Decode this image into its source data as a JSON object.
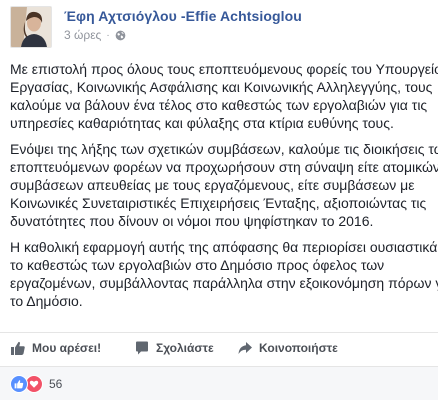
{
  "post": {
    "author": "Έφη Αχτσιόγλου -Effie Achtsioglou",
    "timestamp": "3 ώρες",
    "privacy_icon": "globe-icon",
    "avatar_icon": "profile-photo",
    "paragraphs": [
      {
        "lines": [
          "Με επιστολή προς όλους τους εποπτευόμενους φορείς του Υπουργείου",
          "Εργασίας, Κοινωνικής Ασφάλισης και Κοινωνικής Αλληλεγγύης, τους",
          "καλούμε να βάλουν ένα τέλος στο καθεστώς των εργολαβιών για τις",
          "υπηρεσίες καθαριότητας και φύλαξης στα κτίρια ευθύνης τους."
        ]
      },
      {
        "lines": [
          "Ενόψει της λήξης των σχετικών συμβάσεων, καλούμε τις διοικήσεις των",
          "εποπτευόμενων φορέων να προχωρήσουν στη σύναψη είτε ατομικών",
          "συμβάσεων απευθείας με τους εργαζόμενους, είτε συμβάσεων με",
          "Κοινωνικές Συνεταιριστικές Επιχειρήσεις Ένταξης, αξιοποιώντας τις",
          "δυνατότητες που δίνουν οι νόμοι που ψηφίστηκαν το 2016."
        ]
      },
      {
        "lines": [
          "Η καθολική εφαρμογή αυτής της απόφασης θα περιορίσει ουσιαστικά",
          "το καθεστώς των εργολαβιών στο Δημόσιο προς όφελος των",
          "εργαζομένων, συμβάλλοντας παράλληλα στην εξοικονόμηση πόρων για",
          "το Δημόσιο."
        ]
      }
    ]
  },
  "actions": {
    "like": {
      "label": "Μου αρέσει!",
      "icon": "thumbs-up-icon"
    },
    "comment": {
      "label": "Σχολιάστε",
      "icon": "comment-icon"
    },
    "share": {
      "label": "Κοινοποιήστε",
      "icon": "share-arrow-icon"
    }
  },
  "reactions": {
    "count": "56",
    "types": [
      "like",
      "love"
    ],
    "like_color": "#5890ff",
    "love_color": "#f25268"
  },
  "colors": {
    "author_link": "#365899",
    "text": "#1d2129",
    "meta": "#90949c",
    "action_text": "#4b4f56"
  }
}
